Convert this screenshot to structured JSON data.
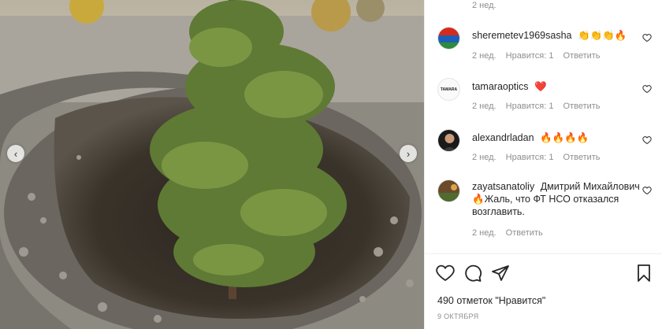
{
  "photo": {
    "prev_icon": "chevron-left-icon",
    "next_icon": "chevron-right-icon"
  },
  "comments": {
    "top_time": "2 нед.",
    "items": [
      {
        "username": "sheremetev1969sasha",
        "text": "👏👏👏🔥",
        "time": "2 нед.",
        "likes": "Нравится: 1",
        "reply": "Ответить"
      },
      {
        "username": "tamaraoptics",
        "text": "❤️",
        "time": "2 нед.",
        "likes": "Нравится: 1",
        "reply": "Ответить"
      },
      {
        "username": "alexandrladan",
        "text": "🔥🔥🔥🔥",
        "time": "2 нед.",
        "likes": "Нравится: 1",
        "reply": "Ответить"
      },
      {
        "username": "zayatsanatoliy",
        "text": "Дмитрий Михайлович 🔥Жаль, что ФТ НСО отказался возглавить.",
        "time": "2 нед.",
        "reply": "Ответить"
      }
    ],
    "avatar_logo_text": "TAMARA"
  },
  "actions": {
    "like_icon": "heart-icon",
    "comment_icon": "comment-icon",
    "share_icon": "paper-plane-icon",
    "save_icon": "bookmark-icon",
    "likes_text": "490 отметок \"Нравится\"",
    "date_text": "9 ОКТЯБРЯ"
  },
  "colors": {
    "secondary_text": "#8e8e8e",
    "primary_text": "#262626",
    "heart_red": "#ed4956",
    "divider": "#efefef"
  }
}
